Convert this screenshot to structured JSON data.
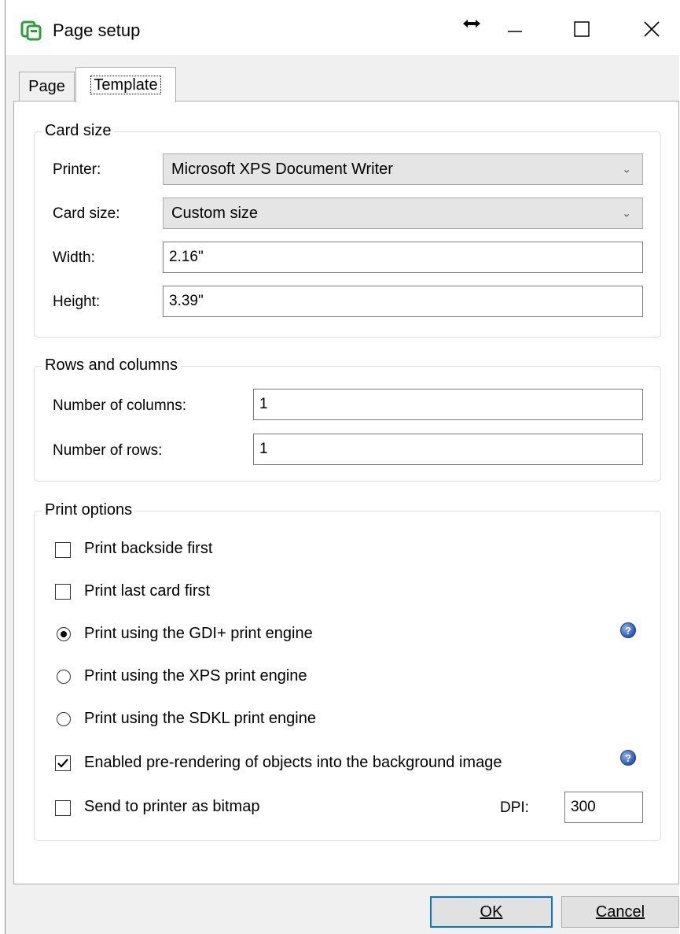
{
  "window": {
    "title": "Page setup",
    "icons": {
      "app": "card-app-icon",
      "resize": "resize-arrows-icon",
      "minimize": "minimize-icon",
      "maximize": "maximize-icon",
      "close": "close-icon"
    }
  },
  "tabs": [
    {
      "label": "Page",
      "active": false
    },
    {
      "label": "Template",
      "active": true
    }
  ],
  "card_size": {
    "title": "Card size",
    "printer_label": "Printer:",
    "printer_value": "Microsoft XPS Document Writer",
    "card_size_label": "Card size:",
    "card_size_value": "Custom size",
    "width_label": "Width:",
    "width_value": "2.16\"",
    "height_label": "Height:",
    "height_value": "3.39\""
  },
  "rows_columns": {
    "title": "Rows and columns",
    "columns_label": "Number of columns:",
    "columns_value": "1",
    "rows_label": "Number of rows:",
    "rows_value": "1"
  },
  "print_options": {
    "title": "Print options",
    "backside_first": {
      "label": "Print backside first",
      "checked": false
    },
    "last_card_first": {
      "label": "Print last card first",
      "checked": false
    },
    "engine_gdi": {
      "label": "Print using the GDI+ print engine",
      "selected": true
    },
    "engine_xps": {
      "label": "Print using the XPS print engine",
      "selected": false
    },
    "engine_sdkl": {
      "label": "Print using the SDKL print engine",
      "selected": false
    },
    "prerender": {
      "label": "Enabled pre-rendering of objects into the background image",
      "checked": true
    },
    "bitmap": {
      "label": "Send to printer as bitmap",
      "checked": false
    },
    "dpi_label": "DPI:",
    "dpi_value": "300",
    "help_icon": "?"
  },
  "buttons": {
    "ok": "OK",
    "cancel": "Cancel"
  }
}
